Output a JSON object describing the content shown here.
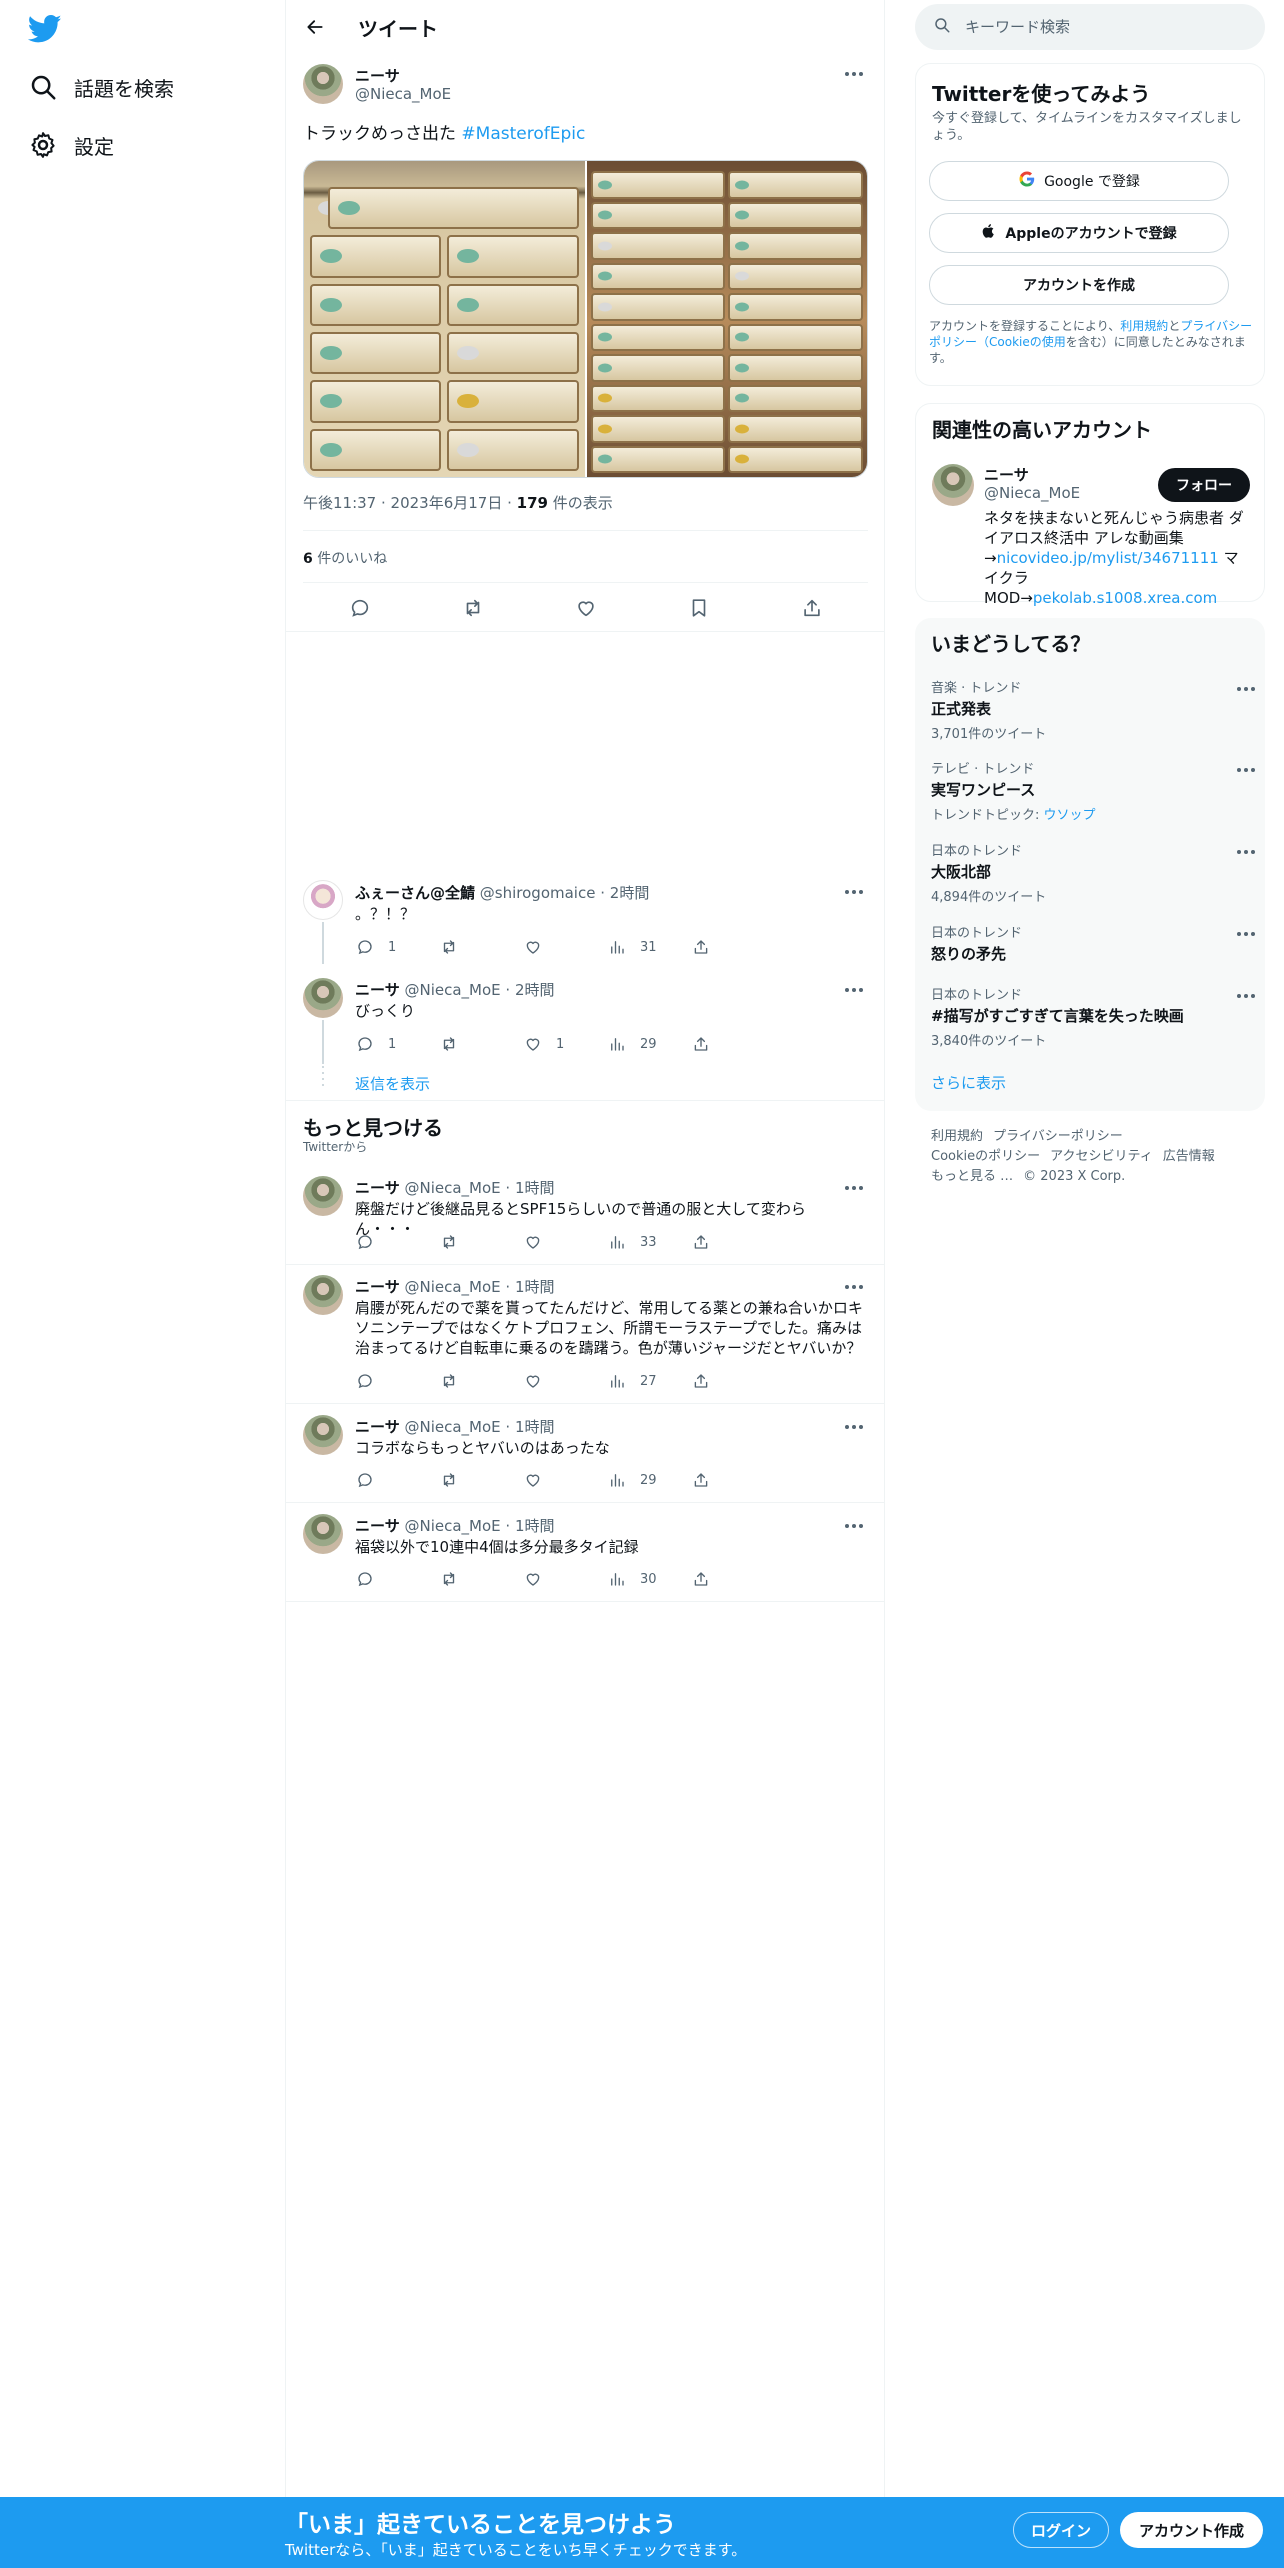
{
  "nav": {
    "items": [
      {
        "label": "話題を検索",
        "icon": "search-icon"
      },
      {
        "label": "設定",
        "icon": "gear-icon"
      }
    ]
  },
  "header": {
    "title": "ツイート"
  },
  "tweet": {
    "name": "ニーサ",
    "handle": "@Nieca_MoE",
    "text": "トラックめっさ出た",
    "hashtag": "#MasterofEpic",
    "time": "午後11:37",
    "date": "2023年6月17日",
    "views_count": "179",
    "views_label": "件の表示",
    "likes_count": "6",
    "likes_label": "件のいいね"
  },
  "replies": [
    {
      "name": "ふぇーさん@全鯖",
      "handle": "@shirogomaice",
      "time": "2時間",
      "text": "。？！？",
      "reply": "1",
      "retweet": "",
      "like": "",
      "views": "31"
    },
    {
      "name": "ニーサ",
      "handle": "@Nieca_MoE",
      "time": "2時間",
      "text": "びっくり",
      "reply": "1",
      "retweet": "",
      "like": "1",
      "views": "29"
    }
  ],
  "show_replies": "返信を表示",
  "discover": {
    "title": "もっと見つける",
    "subtitle": "Twitterから",
    "tweets": [
      {
        "name": "ニーサ",
        "handle": "@Nieca_MoE",
        "time": "1時間",
        "text": "廃盤だけど後継品見るとSPF15らしいので普通の服と大して変わらん・・・",
        "views": "33"
      },
      {
        "name": "ニーサ",
        "handle": "@Nieca_MoE",
        "time": "1時間",
        "text": "肩腰が死んだので薬を貰ってたんだけど、常用してる薬との兼ね合いかロキソニンテープではなくケトプロフェン、所謂モーラステープでした。痛みは治まってるけど自転車に乗るのを躊躇う。色が薄いジャージだとヤバいか？",
        "views": "27"
      },
      {
        "name": "ニーサ",
        "handle": "@Nieca_MoE",
        "time": "1時間",
        "text": "コラボならもっとヤバいのはあったな",
        "views": "29"
      },
      {
        "name": "ニーサ",
        "handle": "@Nieca_MoE",
        "time": "1時間",
        "text": "福袋以外で10連中4個は多分最多タイ記録",
        "views": "30"
      }
    ]
  },
  "search": {
    "placeholder": "キーワード検索"
  },
  "signup": {
    "title": "Twitterを使ってみよう",
    "subtitle": "今すぐ登録して、タイムラインをカスタマイズしましょう。",
    "google": "Google で登録",
    "apple": "Appleのアカウントで登録",
    "create": "アカウントを作成",
    "terms_pre": "アカウントを登録することにより、",
    "terms_link1": "利用規約",
    "terms_mid": "と",
    "terms_link2": "プライバシーポリシー（Cookieの使用",
    "terms_post": "を含む）に同意したとみなされます。"
  },
  "related": {
    "title": "関連性の高いアカウント",
    "name": "ニーサ",
    "handle": "@Nieca_MoE",
    "follow": "フォロー",
    "bio_1": "ネタを挟まないと死んじゃう病患者 ダイアロス終活中 アレな動画集→",
    "bio_link1": "nicovideo.jp/mylist/34671111",
    "bio_2": " マイクラMOD→",
    "bio_link2": "pekolab.s1008.xrea.com"
  },
  "trends": {
    "title": "いまどうしてる？",
    "items": [
      {
        "category": "音楽 · トレンド",
        "name": "正式発表",
        "extra": "3,701件のツイート"
      },
      {
        "category": "テレビ · トレンド",
        "name": "実写ワンピース",
        "extra_pre": "トレンドトピック: ",
        "extra_link": "ウソップ"
      },
      {
        "category": "日本のトレンド",
        "name": "大阪北部",
        "extra": "4,894件のツイート"
      },
      {
        "category": "日本のトレンド",
        "name": "怒りの矛先",
        "extra": ""
      },
      {
        "category": "日本のトレンド",
        "name": "#描写がすごすぎて言葉を失った映画",
        "extra": "3,840件のツイート"
      }
    ],
    "show_more": "さらに表示"
  },
  "footer": {
    "links": [
      "利用規約",
      "プライバシーポリシー",
      "Cookieのポリシー",
      "アクセシビリティ",
      "広告情報",
      "もっと見る …",
      "© 2023 X Corp."
    ]
  },
  "bottom_bar": {
    "title": "「いま」起きていることを見つけよう",
    "subtitle": "Twitterなら、「いま」起きていることをいち早くチェックできます。",
    "login": "ログイン",
    "signup": "アカウント作成"
  },
  "colors": {
    "accent": "#1d9bf0",
    "text": "#0f1419",
    "muted": "#536471",
    "border": "#eff3f4"
  }
}
